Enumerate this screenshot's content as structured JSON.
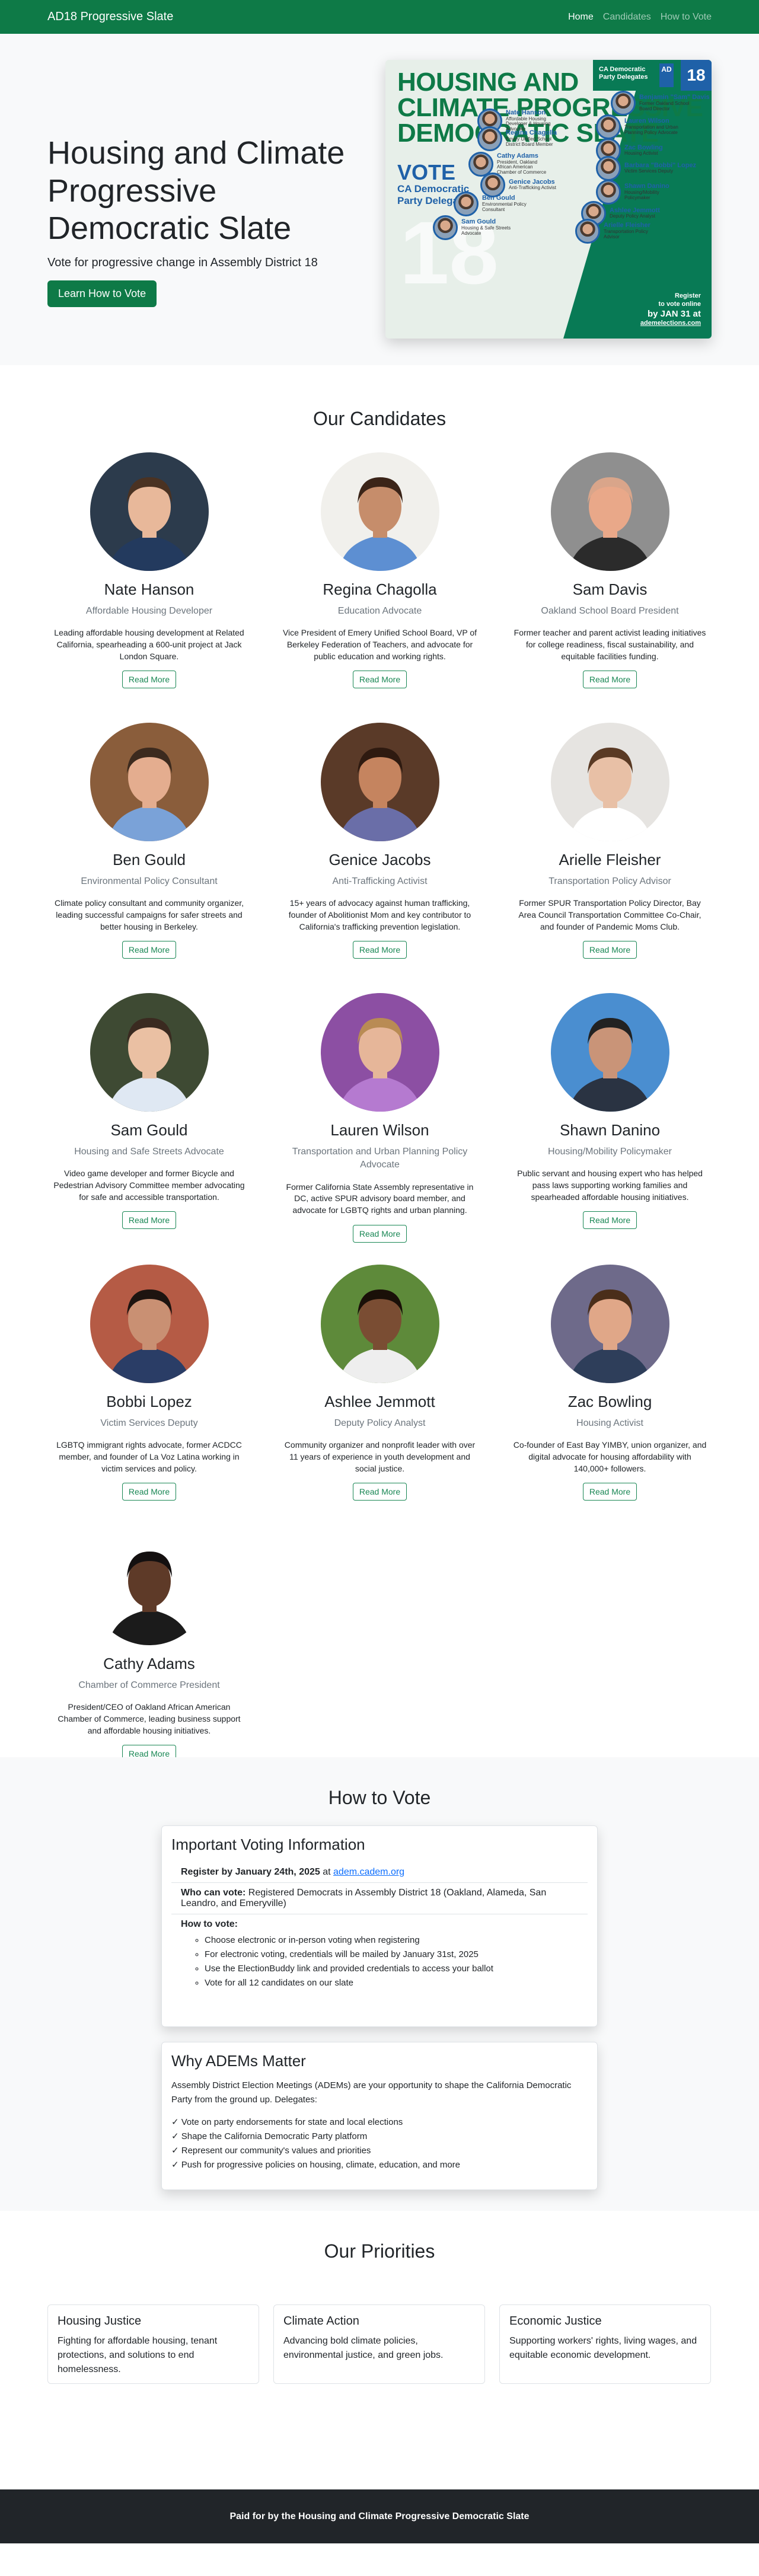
{
  "nav": {
    "brand": "AD18 Progressive Slate",
    "links": [
      "Home",
      "Candidates",
      "How to Vote"
    ]
  },
  "hero": {
    "title": "Housing and Climate Progressive Democratic Slate",
    "subtitle": "Vote for progressive change in Assembly District 18",
    "cta": "Learn How to Vote"
  },
  "poster": {
    "title_l1": "HOUSING AND",
    "title_l2": "CLIMATE PROGRESSIVE",
    "title_l3": "DEMOCRATIC SLATE",
    "vote": "VOTE",
    "sub_l1": "CA Democratic",
    "sub_l2": "Party Delegates",
    "big_number": "18",
    "box_l1": "CA Democratic",
    "box_l2": "Party Delegates",
    "box_ad": "AD",
    "register_l1": "Register",
    "register_l2": "to vote online",
    "register_l3": "by JAN 31 at",
    "register_url": "ademelections.com",
    "candidates": [
      {
        "name": "Benjamin \"Sam\" Davis",
        "desc": "Former Oakland School Board Director"
      },
      {
        "name": "Nate Hanson",
        "desc": "Affordable Housing Developer & Housing Advocate"
      },
      {
        "name": "Lauren Wilson",
        "desc": "Transportation and Urban Planning Policy Advocate"
      },
      {
        "name": "Regina Chagolla",
        "desc": "Emery Unified School District Board Member"
      },
      {
        "name": "Zac Bowling",
        "desc": "Housing Activist"
      },
      {
        "name": "Cathy Adams",
        "desc": "President, Oakland African American Chamber of Commerce"
      },
      {
        "name": "Barbara \"Bobbi\" Lopez",
        "desc": "Victim Services Deputy"
      },
      {
        "name": "Genice Jacobs",
        "desc": "Anti-Trafficking Activist"
      },
      {
        "name": "Shawn Danino",
        "desc": "Housing/Mobility Policymaker"
      },
      {
        "name": "Ben Gould",
        "desc": "Environmental Policy Consultant"
      },
      {
        "name": "Ashlee Jemmott",
        "desc": "Deputy Policy Analyst"
      },
      {
        "name": "Sam Gould",
        "desc": "Housing & Safe Streets Advocate"
      },
      {
        "name": "Arielle Fleisher",
        "desc": "Transportation Policy Advisor"
      }
    ]
  },
  "candidates_section": {
    "title": "Our Candidates",
    "read_more": "Read More",
    "items": [
      {
        "name": "Nate Hanson",
        "role": "Affordable Housing Developer",
        "bio": "Leading affordable housing development at Related California, spearheading a 600-unit project at Jack London Square.",
        "bg": "#2c3b4c",
        "skin": "#e8b89a",
        "hair": "#4a3222",
        "shirt": "#233a5e"
      },
      {
        "name": "Regina Chagolla",
        "role": "Education Advocate",
        "bio": "Vice President of Emery Unified School Board, VP of Berkeley Federation of Teachers, and advocate for public education and working rights.",
        "bg": "#f1f0ec",
        "skin": "#c68d6b",
        "hair": "#3b2418",
        "shirt": "#5d8fd2"
      },
      {
        "name": "Sam Davis",
        "role": "Oakland School Board President",
        "bio": "Former teacher and parent activist leading initiatives for college readiness, fiscal sustainability, and equitable facilities funding.",
        "bg": "#8f8f8f",
        "skin": "#e9a889",
        "hair": "#d9a58a",
        "shirt": "#2b2b2b"
      },
      {
        "name": "Ben Gould",
        "role": "Environmental Policy Consultant",
        "bio": "Climate policy consultant and community organizer, leading successful campaigns for safer streets and better housing in Berkeley.",
        "bg": "#8a5d3b",
        "skin": "#e4ad8f",
        "hair": "#3c2a1e",
        "shirt": "#7aa2d8"
      },
      {
        "name": "Genice Jacobs",
        "role": "Anti-Trafficking Activist",
        "bio": "15+ years of advocacy against human trafficking, founder of Abolitionist Mom and key contributor to California's trafficking prevention legislation.",
        "bg": "#5a3a28",
        "skin": "#c5845f",
        "hair": "#2e1a10",
        "shirt": "#6a6ea8"
      },
      {
        "name": "Arielle Fleisher",
        "role": "Transportation Policy Advisor",
        "bio": "Former SPUR Transportation Policy Director, Bay Area Council Transportation Committee Co-Chair, and founder of Pandemic Moms Club.",
        "bg": "#e6e4e1",
        "skin": "#e8c0a6",
        "hair": "#5a3a24",
        "shirt": "#ffffff"
      },
      {
        "name": "Sam Gould",
        "role": "Housing and Safe Streets Advocate",
        "bio": "Video game developer and former Bicycle and Pedestrian Advisory Committee member advocating for safe and accessible transportation.",
        "bg": "#3e4a33",
        "skin": "#eac0a3",
        "hair": "#3a2a20",
        "shirt": "#dfe8f3"
      },
      {
        "name": "Lauren Wilson",
        "role": "Transportation and Urban Planning Policy Advocate",
        "bio": "Former California State Assembly representative in DC, active SPUR advisory board member, and advocate for LGBTQ rights and urban planning.",
        "bg": "#8c4fa3",
        "skin": "#e6b699",
        "hair": "#b98b54",
        "shirt": "#b57ad0"
      },
      {
        "name": "Shawn Danino",
        "role": "Housing/Mobility Policymaker",
        "bio": "Public servant and housing expert who has helped pass laws supporting working families and spearheaded affordable housing initiatives.",
        "bg": "#4a8ed0",
        "skin": "#c99478",
        "hair": "#222222",
        "shirt": "#2a3342"
      },
      {
        "name": "Bobbi Lopez",
        "role": "Victim Services Deputy",
        "bio": "LGBTQ immigrant rights advocate, former ACDCC member, and founder of La Voz Latina working in victim services and policy.",
        "bg": "#b55b45",
        "skin": "#c99073",
        "hair": "#1e1410",
        "shirt": "#2a3d66"
      },
      {
        "name": "Ashlee Jemmott",
        "role": "Deputy Policy Analyst",
        "bio": "Community organizer and nonprofit leader with over 11 years of experience in youth development and social justice.",
        "bg": "#5e8a3a",
        "skin": "#7a4d33",
        "hair": "#1a1008",
        "shirt": "#eeeeee"
      },
      {
        "name": "Zac Bowling",
        "role": "Housing Activist",
        "bio": "Co-founder of East Bay YIMBY, union organizer, and digital advocate for housing affordability with 140,000+ followers.",
        "bg": "#6e6a8a",
        "skin": "#e0a788",
        "hair": "#4a2e1a",
        "shirt": "#2e3e5a"
      },
      {
        "name": "Cathy Adams",
        "role": "Chamber of Commerce President",
        "bio": "President/CEO of Oakland African American Chamber of Commerce, leading business support and affordable housing initiatives.",
        "bg": "#ffffff",
        "skin": "#5e3a28",
        "hair": "#141010",
        "shirt": "#1b1b1b"
      }
    ]
  },
  "vote": {
    "title": "How to Vote",
    "card1_title": "Important Voting Information",
    "register_bold": "Register by January 24th, 2025",
    "register_at": " at ",
    "register_link": "adem.cadem.org",
    "who_label": "Who can vote:",
    "who_text": " Registered Democrats in Assembly District 18 (Oakland, Alameda, San Leandro, and Emeryville)",
    "how_label": "How to vote:",
    "how_steps": [
      "Choose electronic or in-person voting when registering",
      "For electronic voting, credentials will be mailed by January 31st, 2025",
      "Use the ElectionBuddy link and provided credentials to access your ballot",
      "Vote for all 12 candidates on our slate"
    ],
    "card2_title": "Why ADEMs Matter",
    "card2_intro": "Assembly District Election Meetings (ADEMs) are your opportunity to shape the California Democratic Party from the ground up. Delegates:",
    "card2_points": [
      "✓ Vote on party endorsements for state and local elections",
      "✓ Shape the California Democratic Party platform",
      "✓ Represent our community's values and priorities",
      "✓ Push for progressive policies on housing, climate, education, and more"
    ]
  },
  "priorities": {
    "title": "Our Priorities",
    "items": [
      {
        "title": "Housing Justice",
        "text": "Fighting for affordable housing, tenant protections, and solutions to end homelessness."
      },
      {
        "title": "Climate Action",
        "text": "Advancing bold climate policies, environmental justice, and green jobs."
      },
      {
        "title": "Economic Justice",
        "text": "Supporting workers' rights, living wages, and equitable economic development."
      }
    ]
  },
  "footer": {
    "text": "Paid for by the Housing and Climate Progressive Democratic Slate"
  }
}
